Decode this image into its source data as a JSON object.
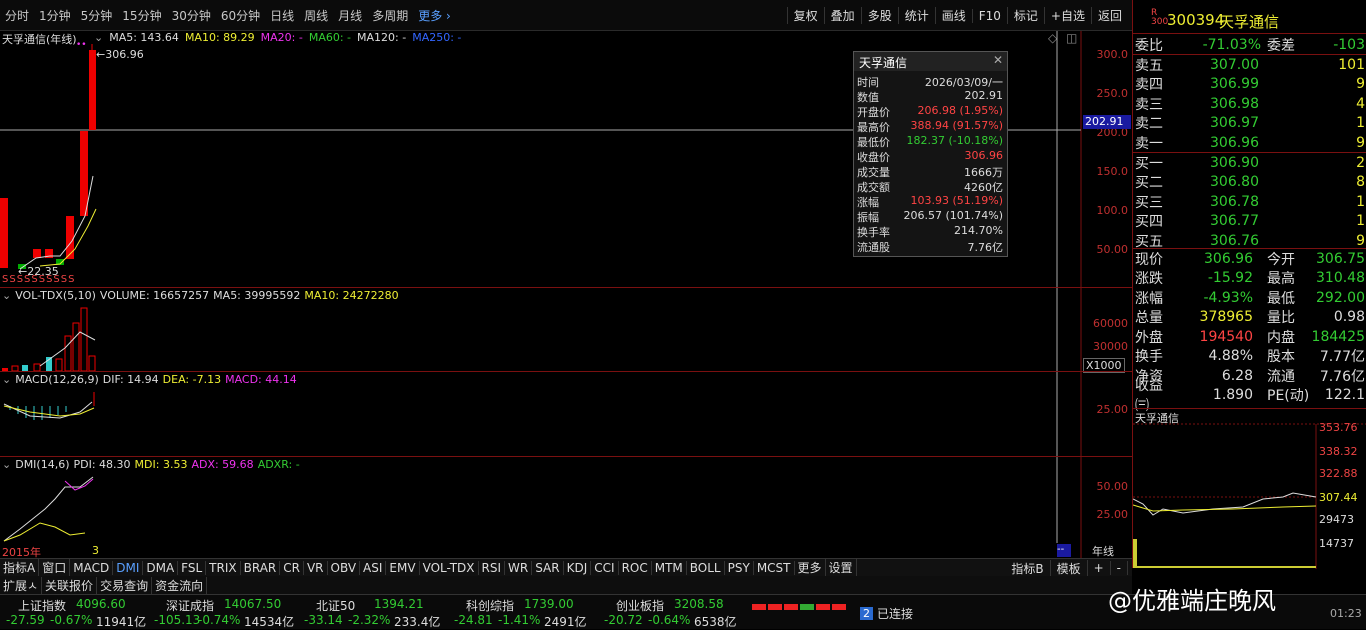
{
  "topbar": {
    "tabs": [
      "分时",
      "1分钟",
      "5分钟",
      "15分钟",
      "30分钟",
      "60分钟",
      "日线",
      "周线",
      "月线",
      "多周期"
    ],
    "more": "更多",
    "right_buttons": [
      "复权",
      "叠加",
      "多股",
      "统计",
      "画线",
      "F10",
      "标记",
      "+自选",
      "返回"
    ]
  },
  "kline": {
    "title": "天孚通信(年线)",
    "ma5": "MA5: 143.64",
    "ma10": "MA10: 89.29",
    "ma20": "MA20: -",
    "ma60": "MA60: -",
    "ma120": "MA120: -",
    "ma250": "MA250: -",
    "high_label": "306.96",
    "low_label": "22.35",
    "y_ticks": [
      "300.0",
      "250.0",
      "200.0",
      "150.0",
      "100.0",
      "50.00"
    ],
    "crosshair_value": "202.91",
    "start_year": "2015年",
    "s_marks": "SSSSSSSSSS"
  },
  "vol": {
    "title": "VOL-TDX(5,10)",
    "volume": "VOLUME: 16657257",
    "ma5": "MA5: 39995592",
    "ma10": "MA10: 24272280",
    "y_ticks": [
      "60000",
      "30000"
    ],
    "unit": "X1000"
  },
  "macd": {
    "title": "MACD(12,26,9)",
    "dif": "DIF: 14.94",
    "dea": "DEA: -7.13",
    "macd": "MACD: 44.14",
    "y_ticks": [
      "25.00"
    ]
  },
  "dmi": {
    "title": "DMI(14,6)",
    "pdi": "PDI: 48.30",
    "mdi": "MDI: 3.53",
    "adx": "ADX: 59.68",
    "adxr": "ADXR: -",
    "y_ticks": [
      "50.00",
      "25.00"
    ],
    "period": "年线",
    "dash": "--"
  },
  "popup": {
    "title": "天孚通信",
    "rows": [
      {
        "k": "时间",
        "v": "2026/03/09/一",
        "c": "white"
      },
      {
        "k": "数值",
        "v": "202.91",
        "c": "white"
      },
      {
        "k": "开盘价",
        "v": "206.98 (1.95%)",
        "c": "red"
      },
      {
        "k": "最高价",
        "v": "388.94 (91.57%)",
        "c": "red"
      },
      {
        "k": "最低价",
        "v": "182.37 (-10.18%)",
        "c": "green"
      },
      {
        "k": "收盘价",
        "v": "306.96",
        "c": "red"
      },
      {
        "k": "成交量",
        "v": "1666万",
        "c": "white"
      },
      {
        "k": "成交额",
        "v": "4260亿",
        "c": "white"
      },
      {
        "k": "涨幅",
        "v": "103.93 (51.19%)",
        "c": "red"
      },
      {
        "k": "振幅",
        "v": "206.57 (101.74%)",
        "c": "white"
      },
      {
        "k": "换手率",
        "v": "214.70%",
        "c": "white"
      },
      {
        "k": "流通股",
        "v": "7.76亿",
        "c": "white"
      }
    ]
  },
  "quote": {
    "code": "300394",
    "name": "天孚通信",
    "r_badge": "R",
    "board": "300",
    "weibi": {
      "k": "委比",
      "v": "-71.03%",
      "k2": "委差",
      "v2": "-103"
    },
    "sells": [
      {
        "n": "卖五",
        "p": "307.00",
        "v": "101"
      },
      {
        "n": "卖四",
        "p": "306.99",
        "v": "9"
      },
      {
        "n": "卖三",
        "p": "306.98",
        "v": "4"
      },
      {
        "n": "卖二",
        "p": "306.97",
        "v": "1"
      },
      {
        "n": "卖一",
        "p": "306.96",
        "v": "9"
      }
    ],
    "buys": [
      {
        "n": "买一",
        "p": "306.90",
        "v": "2"
      },
      {
        "n": "买二",
        "p": "306.80",
        "v": "8"
      },
      {
        "n": "买三",
        "p": "306.78",
        "v": "1"
      },
      {
        "n": "买四",
        "p": "306.77",
        "v": "1"
      },
      {
        "n": "买五",
        "p": "306.76",
        "v": "9"
      }
    ],
    "stats": [
      {
        "k": "现价",
        "v": "306.96",
        "c": "green",
        "k2": "今开",
        "v2": "306.75",
        "c2": "green"
      },
      {
        "k": "涨跌",
        "v": "-15.92",
        "c": "green",
        "k2": "最高",
        "v2": "310.48",
        "c2": "green"
      },
      {
        "k": "涨幅",
        "v": "-4.93%",
        "c": "green",
        "k2": "最低",
        "v2": "292.00",
        "c2": "green"
      },
      {
        "k": "总量",
        "v": "378965",
        "c": "yellow",
        "k2": "量比",
        "v2": "0.98",
        "c2": "white"
      },
      {
        "k": "外盘",
        "v": "194540",
        "c": "red",
        "k2": "内盘",
        "v2": "184425",
        "c2": "green"
      },
      {
        "k": "换手",
        "v": "4.88%",
        "c": "white",
        "k2": "股本",
        "v2": "7.77亿",
        "c2": "white"
      },
      {
        "k": "净资",
        "v": "6.28",
        "c": "white",
        "k2": "流通",
        "v2": "7.76亿",
        "c2": "white"
      },
      {
        "k": "收益㈢",
        "v": "1.890",
        "c": "white",
        "k2": "PE(动)",
        "v2": "122.1",
        "c2": "white"
      }
    ]
  },
  "mini": {
    "title": "天孚通信",
    "y_ticks": [
      "353.76",
      "338.32",
      "322.88",
      "307.44",
      "29473",
      "14737"
    ]
  },
  "bottomtabs": [
    "指标A",
    "窗口",
    "MACD",
    "DMI",
    "DMA",
    "FSL",
    "TRIX",
    "BRAR",
    "CR",
    "VR",
    "OBV",
    "ASI",
    "EMV",
    "VOL-TDX",
    "RSI",
    "WR",
    "SAR",
    "KDJ",
    "CCI",
    "ROC",
    "MTM",
    "BOLL",
    "PSY",
    "MCST",
    "更多",
    "设置"
  ],
  "bottom_right": [
    "指标B",
    "模板",
    "+",
    "-"
  ],
  "tabs2": [
    "扩展ㅅ",
    "关联报价",
    "交易查询",
    "资金流向"
  ],
  "status": {
    "indices": [
      {
        "name": "上证指数",
        "val": "4096.60",
        "chg": "-27.59",
        "pct": "-0.67%",
        "amt": "11941亿"
      },
      {
        "name": "深证成指",
        "val": "14067.50",
        "chg": "-105.13",
        "pct": "-0.74%",
        "amt": "14534亿"
      },
      {
        "name": "北证50",
        "val": "1394.21",
        "chg": "-33.14",
        "pct": "-2.32%",
        "amt": "233.4亿"
      },
      {
        "name": "科创综指",
        "val": "1739.00",
        "chg": "-24.81",
        "pct": "-1.41%",
        "amt": "2491亿"
      },
      {
        "name": "创业板指",
        "val": "3208.58",
        "chg": "-20.72",
        "pct": "-0.64%",
        "amt": "6538亿"
      }
    ],
    "connected": "已连接",
    "conn_num": "2",
    "watermark": "@优雅端庄晚风",
    "time": "01:23"
  }
}
